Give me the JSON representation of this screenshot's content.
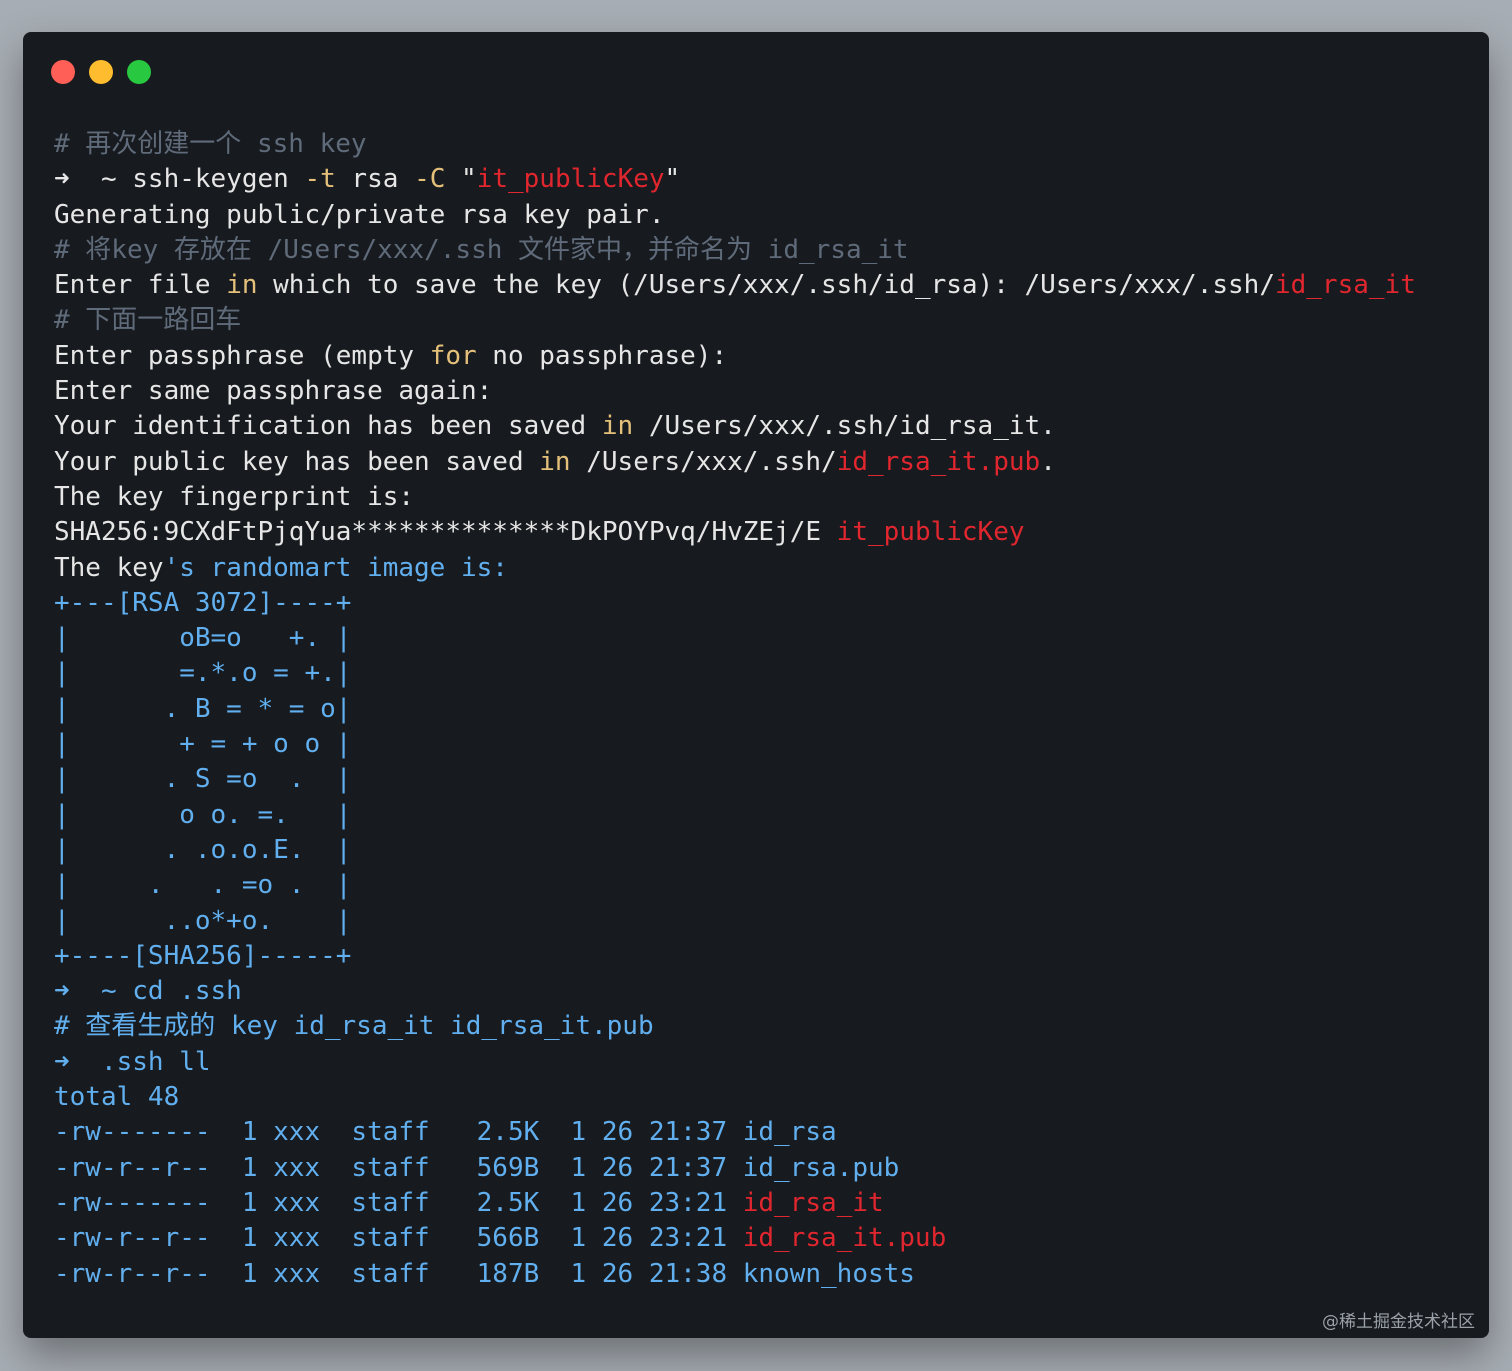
{
  "window": {
    "colors": {
      "close": "#ff5f57",
      "minimize": "#febc2e",
      "zoom": "#28c840"
    }
  },
  "lines": [
    [
      {
        "t": "# 再次创建一个 ssh key",
        "c": "comment"
      }
    ],
    [
      {
        "t": "➜  ~ ",
        "c": "plain"
      },
      {
        "t": "ssh-keygen ",
        "c": "plain"
      },
      {
        "t": "-t",
        "c": "flag"
      },
      {
        "t": " rsa ",
        "c": "plain"
      },
      {
        "t": "-C",
        "c": "flag"
      },
      {
        "t": " \"",
        "c": "plain"
      },
      {
        "t": "it_publicKey",
        "c": "red"
      },
      {
        "t": "\"",
        "c": "plain"
      }
    ],
    [
      {
        "t": "Generating public/private rsa key pair.",
        "c": "plain"
      }
    ],
    [
      {
        "t": "# 将key 存放在 /Users/xxx/.ssh 文件家中，并命名为 id_rsa_it",
        "c": "comment"
      }
    ],
    [
      {
        "t": "Enter file ",
        "c": "plain"
      },
      {
        "t": "in",
        "c": "kw"
      },
      {
        "t": " which to save the key (/Users/xxx/.ssh/id_rsa): /Users/xxx/.ssh/",
        "c": "plain"
      },
      {
        "t": "id_rsa_it",
        "c": "red"
      }
    ],
    [
      {
        "t": "# 下面一路回车",
        "c": "comment"
      }
    ],
    [
      {
        "t": "Enter passphrase (empty ",
        "c": "plain"
      },
      {
        "t": "for",
        "c": "kw"
      },
      {
        "t": " no passphrase):",
        "c": "plain"
      }
    ],
    [
      {
        "t": "Enter same passphrase again:",
        "c": "plain"
      }
    ],
    [
      {
        "t": "Your identification has been saved ",
        "c": "plain"
      },
      {
        "t": "in",
        "c": "kw"
      },
      {
        "t": " /Users/xxx/.ssh/id_rsa_it.",
        "c": "plain"
      }
    ],
    [
      {
        "t": "Your public key has been saved ",
        "c": "plain"
      },
      {
        "t": "in",
        "c": "kw"
      },
      {
        "t": " /Users/xxx/.ssh/",
        "c": "plain"
      },
      {
        "t": "id_rsa_it.pub",
        "c": "red"
      },
      {
        "t": ".",
        "c": "plain"
      }
    ],
    [
      {
        "t": "The key fingerprint is:",
        "c": "plain"
      }
    ],
    [
      {
        "t": "SHA256:9CXdFtPjqYua**************DkPOYPvq/HvZEj/E ",
        "c": "plain"
      },
      {
        "t": "it_publicKey",
        "c": "red"
      }
    ],
    [
      {
        "t": "The key",
        "c": "plain"
      },
      {
        "t": "'s randomart image is:",
        "c": "blue"
      }
    ],
    [
      {
        "t": "+---[RSA 3072]----+",
        "c": "blue"
      }
    ],
    [
      {
        "t": "|       oB=o   +. |",
        "c": "blue"
      }
    ],
    [
      {
        "t": "|       =.*.o = +.|",
        "c": "blue"
      }
    ],
    [
      {
        "t": "|      . B = * = o|",
        "c": "blue"
      }
    ],
    [
      {
        "t": "|       + = + o o |",
        "c": "blue"
      }
    ],
    [
      {
        "t": "|      . S =o  .  |",
        "c": "blue"
      }
    ],
    [
      {
        "t": "|       o o. =.   |",
        "c": "blue"
      }
    ],
    [
      {
        "t": "|      . .o.o.E.  |",
        "c": "blue"
      }
    ],
    [
      {
        "t": "|     .   . =o .  |",
        "c": "blue"
      }
    ],
    [
      {
        "t": "|      ..o*+o.    |",
        "c": "blue"
      }
    ],
    [
      {
        "t": "+----[SHA256]-----+",
        "c": "blue"
      }
    ],
    [
      {
        "t": "➜  ~ cd .ssh",
        "c": "blue"
      }
    ],
    [
      {
        "t": "# 查看生成的 key id_rsa_it id_rsa_it.pub",
        "c": "blue"
      }
    ],
    [
      {
        "t": "➜  .ssh ll",
        "c": "blue"
      }
    ],
    [
      {
        "t": "total 48",
        "c": "blue"
      }
    ],
    [
      {
        "t": "-rw-------  1 xxx  staff   2.5K  1 26 21:37 id_rsa",
        "c": "blue"
      }
    ],
    [
      {
        "t": "-rw-r--r--  1 xxx  staff   569B  1 26 21:37 id_rsa.pub",
        "c": "blue"
      }
    ],
    [
      {
        "t": "-rw-------  1 xxx  staff   2.5K  1 26 23:21 ",
        "c": "blue"
      },
      {
        "t": "id_rsa_it",
        "c": "red"
      }
    ],
    [
      {
        "t": "-rw-r--r--  1 xxx  staff   566B  1 26 23:21 ",
        "c": "blue"
      },
      {
        "t": "id_rsa_it.pub",
        "c": "red"
      }
    ],
    [
      {
        "t": "-rw-r--r--  1 xxx  staff   187B  1 26 21:38 known_hosts",
        "c": "blue"
      }
    ]
  ],
  "watermark": "@稀土掘金技术社区"
}
